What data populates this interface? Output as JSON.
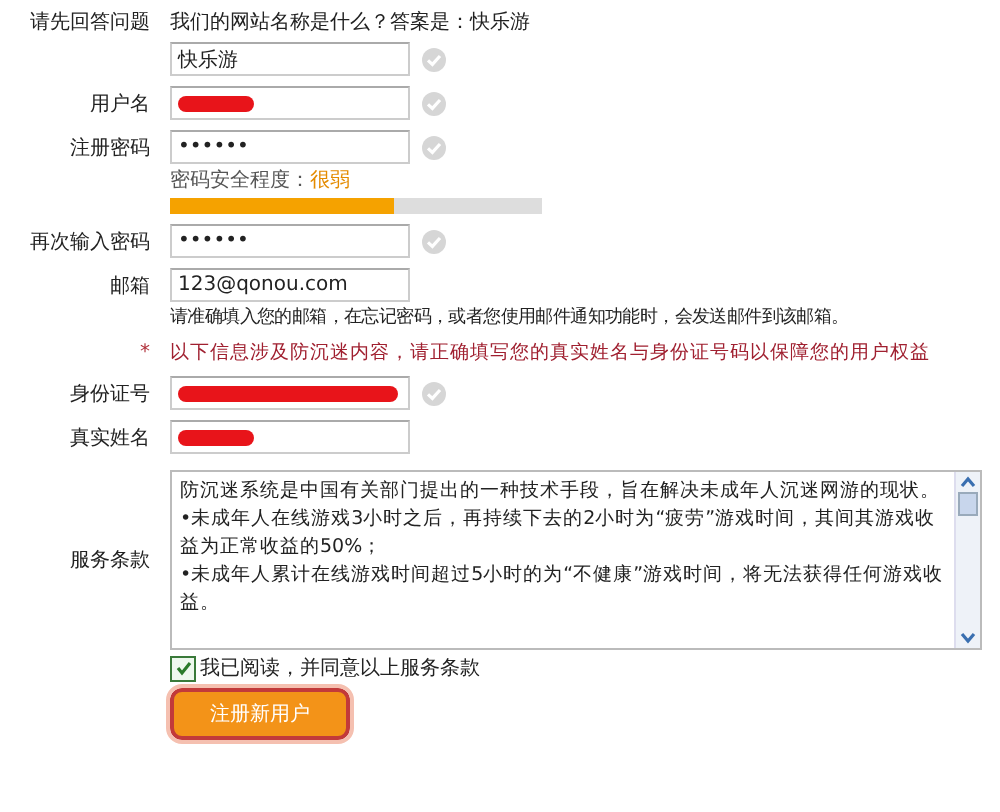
{
  "rows": [
    {
      "kind": "question",
      "label": "请先回答问题",
      "text": "我们的网站名称是什么？答案是：快乐游"
    },
    {
      "kind": "field",
      "label": "",
      "value": "快乐游",
      "check": true
    },
    {
      "kind": "field",
      "label": "用户名",
      "redacted": true,
      "check": true
    },
    {
      "kind": "field",
      "label": "注册密码",
      "value": "••••••",
      "check": true
    },
    {
      "kind": "strength",
      "label": "",
      "text": "密码安全程度：",
      "rating": "很弱",
      "level": 0.6
    },
    {
      "kind": "field",
      "label": "再次输入密码",
      "value": "••••••",
      "check": true
    },
    {
      "kind": "field",
      "label": "邮箱",
      "value": "123@qonou.com",
      "check": false
    },
    {
      "kind": "hint",
      "label": "",
      "text": "请准确填入您的邮箱，在忘记密码，或者您使用邮件通知功能时，会发送邮件到该邮箱。"
    },
    {
      "kind": "notice",
      "label": "*",
      "text": "以下信息涉及防沉迷内容，请正确填写您的真实姓名与身份证号码以保障您的用户权益"
    },
    {
      "kind": "field",
      "label": "身份证号",
      "redacted": true,
      "redaction_full": true,
      "check": true
    },
    {
      "kind": "field",
      "label": "真实姓名",
      "redacted": true,
      "check": false
    },
    {
      "kind": "terms",
      "label": "服务条款",
      "paragraphs": [
        "防沉迷系统是中国有关部门提出的一种技术手段，旨在解决未成年人沉迷网游的现状。",
        "•未成年人在线游戏3小时之后，再持续下去的2小时为“疲劳”游戏时间，其间其游戏收益为正常收益的50%；",
        "•未成年人累计在线游戏时间超过5小时的为“不健康”游戏时间，将无法获得任何游戏收益。"
      ]
    }
  ],
  "agree": {
    "label": "我已阅读，并同意以上服务条款",
    "checked": true
  },
  "submit": "注册新用户"
}
